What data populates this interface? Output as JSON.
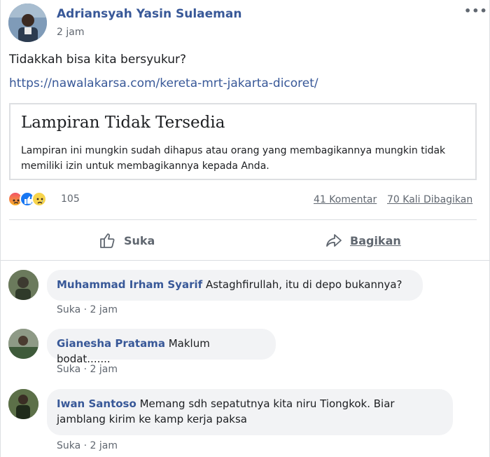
{
  "post": {
    "author": "Adriansyah Yasin Sulaeman",
    "time": "2 jam",
    "text": "Tidakkah bisa kita bersyukur?",
    "link": "https://nawalakarsa.com/kereta-mrt-jakarta-dicoret/",
    "more_icon": "more-options-icon"
  },
  "attachment": {
    "title": "Lampiran Tidak Tersedia",
    "description": "Lampiran ini mungkin sudah dihapus atau orang yang membagikannya mungkin tidak memiliki izin untuk membagikannya kepada Anda."
  },
  "stats": {
    "reactions": [
      "angry",
      "like",
      "sad"
    ],
    "reaction_count": "105",
    "comments": "41 Komentar",
    "shares": "70 Kali Dibagikan"
  },
  "actions": {
    "like_label": "Suka",
    "share_label": "Bagikan"
  },
  "comments": [
    {
      "name": "Muhammad Irham Syarif",
      "text": "Astaghfirullah, itu di depo bukannya?",
      "meta": "Suka · 2 jam"
    },
    {
      "name": "Gianesha Pratama",
      "text": "Maklum bodat.......",
      "meta": "Suka · 2 jam"
    },
    {
      "name": "Iwan Santoso",
      "text": "Memang sdh sepatutnya kita niru Tiongkok. Biar jamblang kirim ke kamp kerja paksa",
      "meta": "Suka · 2 jam"
    }
  ],
  "colors": {
    "link": "#385898",
    "secondary": "#606770",
    "like_blue": "#1877f2"
  }
}
